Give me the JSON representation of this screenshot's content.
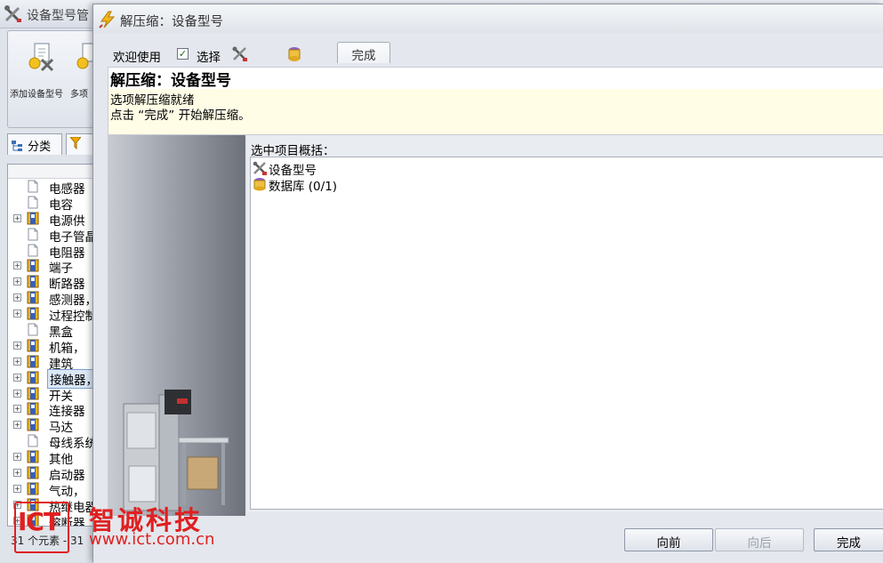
{
  "background_window": {
    "title": "设备型号管",
    "ribbon": {
      "buttons": [
        {
          "label": "添加设备型号",
          "icon": "add-device-icon"
        },
        {
          "label": "多项",
          "icon": "multi-device-icon"
        }
      ]
    },
    "tabs": [
      {
        "label": "分类",
        "icon": "category-icon"
      },
      {
        "label": "",
        "icon": "filter-icon"
      }
    ],
    "tree": [
      {
        "label": "电感器",
        "expandable": false,
        "icon": "page"
      },
      {
        "label": "电容",
        "expandable": false,
        "icon": "page"
      },
      {
        "label": "电源供",
        "expandable": true,
        "icon": "book"
      },
      {
        "label": "电子管晶",
        "expandable": false,
        "icon": "page"
      },
      {
        "label": "电阻器",
        "expandable": false,
        "icon": "page"
      },
      {
        "label": "端子",
        "expandable": true,
        "icon": "book"
      },
      {
        "label": "断路器",
        "expandable": true,
        "icon": "book"
      },
      {
        "label": "感测器，",
        "expandable": true,
        "icon": "book"
      },
      {
        "label": "过程控制",
        "expandable": true,
        "icon": "book"
      },
      {
        "label": "黑盒",
        "expandable": false,
        "icon": "page"
      },
      {
        "label": "机箱，",
        "expandable": true,
        "icon": "book"
      },
      {
        "label": "建筑",
        "expandable": true,
        "icon": "book"
      },
      {
        "label": "接触器，",
        "expandable": true,
        "icon": "book",
        "selected": true
      },
      {
        "label": "开关",
        "expandable": true,
        "icon": "book"
      },
      {
        "label": "连接器",
        "expandable": true,
        "icon": "book"
      },
      {
        "label": "马达",
        "expandable": true,
        "icon": "book"
      },
      {
        "label": "母线系统",
        "expandable": false,
        "icon": "page"
      },
      {
        "label": "其他",
        "expandable": true,
        "icon": "book"
      },
      {
        "label": "启动器",
        "expandable": true,
        "icon": "book"
      },
      {
        "label": "气动，",
        "expandable": true,
        "icon": "book"
      },
      {
        "label": "热继电器",
        "expandable": true,
        "icon": "book"
      },
      {
        "label": "熔断器",
        "expandable": true,
        "icon": "book"
      }
    ],
    "status": "31 个元素 - 31"
  },
  "dialog": {
    "title": "解压缩：设备型号",
    "toolbar": {
      "welcome": "欢迎使用",
      "select": "选择",
      "done_tab": "完成"
    },
    "header": {
      "title": "解压缩：设备型号",
      "line1": "选项解压缩就绪",
      "line2": "点击 “完成” 开始解压缩。"
    },
    "summary_label": "选中项目概括：",
    "summary_items": [
      {
        "label": "设备型号",
        "icon": "tools-icon"
      },
      {
        "label": "数据库 (0/1)",
        "icon": "database-icon"
      }
    ],
    "buttons": {
      "back": "向前",
      "next": "向后",
      "finish": "完成"
    }
  },
  "watermark": {
    "logo": "ICT",
    "company": "智诚科技",
    "url": "www.ict.com.cn"
  },
  "colors": {
    "watermark_red": "#e02020",
    "header_bg": "#fffde6",
    "selection": "#dce8f7"
  }
}
